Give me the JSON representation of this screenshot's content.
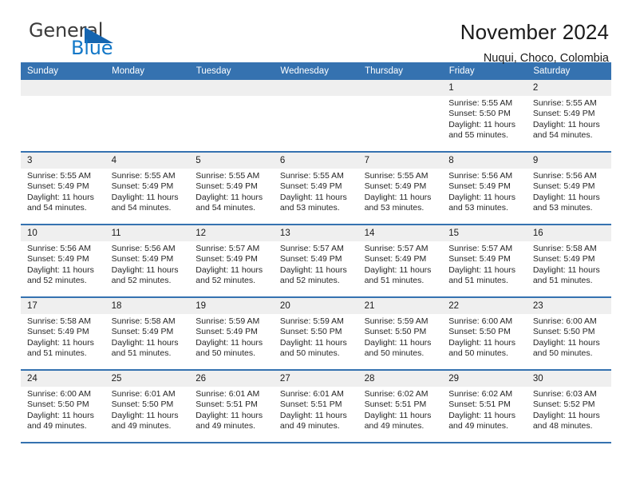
{
  "brand": {
    "name_part1": "General",
    "name_part2": "Blue",
    "triangle_icon": "triangle-icon"
  },
  "header": {
    "title": "November 2024",
    "subtitle": "Nuqui, Choco, Colombia"
  },
  "colors": {
    "header_blue": "#3572b0",
    "brand_blue": "#1378c8",
    "daynum_gray": "#efefef"
  },
  "calendar": {
    "weekdays": [
      "Sunday",
      "Monday",
      "Tuesday",
      "Wednesday",
      "Thursday",
      "Friday",
      "Saturday"
    ],
    "labels": {
      "sunrise": "Sunrise:",
      "sunset": "Sunset:",
      "daylight": "Daylight:"
    },
    "weeks": [
      [
        {
          "day": ""
        },
        {
          "day": ""
        },
        {
          "day": ""
        },
        {
          "day": ""
        },
        {
          "day": ""
        },
        {
          "day": "1",
          "sunrise": "Sunrise: 5:55 AM",
          "sunset": "Sunset: 5:50 PM",
          "daylight_1": "Daylight: 11 hours",
          "daylight_2": "and 55 minutes."
        },
        {
          "day": "2",
          "sunrise": "Sunrise: 5:55 AM",
          "sunset": "Sunset: 5:49 PM",
          "daylight_1": "Daylight: 11 hours",
          "daylight_2": "and 54 minutes."
        }
      ],
      [
        {
          "day": "3",
          "sunrise": "Sunrise: 5:55 AM",
          "sunset": "Sunset: 5:49 PM",
          "daylight_1": "Daylight: 11 hours",
          "daylight_2": "and 54 minutes."
        },
        {
          "day": "4",
          "sunrise": "Sunrise: 5:55 AM",
          "sunset": "Sunset: 5:49 PM",
          "daylight_1": "Daylight: 11 hours",
          "daylight_2": "and 54 minutes."
        },
        {
          "day": "5",
          "sunrise": "Sunrise: 5:55 AM",
          "sunset": "Sunset: 5:49 PM",
          "daylight_1": "Daylight: 11 hours",
          "daylight_2": "and 54 minutes."
        },
        {
          "day": "6",
          "sunrise": "Sunrise: 5:55 AM",
          "sunset": "Sunset: 5:49 PM",
          "daylight_1": "Daylight: 11 hours",
          "daylight_2": "and 53 minutes."
        },
        {
          "day": "7",
          "sunrise": "Sunrise: 5:55 AM",
          "sunset": "Sunset: 5:49 PM",
          "daylight_1": "Daylight: 11 hours",
          "daylight_2": "and 53 minutes."
        },
        {
          "day": "8",
          "sunrise": "Sunrise: 5:56 AM",
          "sunset": "Sunset: 5:49 PM",
          "daylight_1": "Daylight: 11 hours",
          "daylight_2": "and 53 minutes."
        },
        {
          "day": "9",
          "sunrise": "Sunrise: 5:56 AM",
          "sunset": "Sunset: 5:49 PM",
          "daylight_1": "Daylight: 11 hours",
          "daylight_2": "and 53 minutes."
        }
      ],
      [
        {
          "day": "10",
          "sunrise": "Sunrise: 5:56 AM",
          "sunset": "Sunset: 5:49 PM",
          "daylight_1": "Daylight: 11 hours",
          "daylight_2": "and 52 minutes."
        },
        {
          "day": "11",
          "sunrise": "Sunrise: 5:56 AM",
          "sunset": "Sunset: 5:49 PM",
          "daylight_1": "Daylight: 11 hours",
          "daylight_2": "and 52 minutes."
        },
        {
          "day": "12",
          "sunrise": "Sunrise: 5:57 AM",
          "sunset": "Sunset: 5:49 PM",
          "daylight_1": "Daylight: 11 hours",
          "daylight_2": "and 52 minutes."
        },
        {
          "day": "13",
          "sunrise": "Sunrise: 5:57 AM",
          "sunset": "Sunset: 5:49 PM",
          "daylight_1": "Daylight: 11 hours",
          "daylight_2": "and 52 minutes."
        },
        {
          "day": "14",
          "sunrise": "Sunrise: 5:57 AM",
          "sunset": "Sunset: 5:49 PM",
          "daylight_1": "Daylight: 11 hours",
          "daylight_2": "and 51 minutes."
        },
        {
          "day": "15",
          "sunrise": "Sunrise: 5:57 AM",
          "sunset": "Sunset: 5:49 PM",
          "daylight_1": "Daylight: 11 hours",
          "daylight_2": "and 51 minutes."
        },
        {
          "day": "16",
          "sunrise": "Sunrise: 5:58 AM",
          "sunset": "Sunset: 5:49 PM",
          "daylight_1": "Daylight: 11 hours",
          "daylight_2": "and 51 minutes."
        }
      ],
      [
        {
          "day": "17",
          "sunrise": "Sunrise: 5:58 AM",
          "sunset": "Sunset: 5:49 PM",
          "daylight_1": "Daylight: 11 hours",
          "daylight_2": "and 51 minutes."
        },
        {
          "day": "18",
          "sunrise": "Sunrise: 5:58 AM",
          "sunset": "Sunset: 5:49 PM",
          "daylight_1": "Daylight: 11 hours",
          "daylight_2": "and 51 minutes."
        },
        {
          "day": "19",
          "sunrise": "Sunrise: 5:59 AM",
          "sunset": "Sunset: 5:49 PM",
          "daylight_1": "Daylight: 11 hours",
          "daylight_2": "and 50 minutes."
        },
        {
          "day": "20",
          "sunrise": "Sunrise: 5:59 AM",
          "sunset": "Sunset: 5:50 PM",
          "daylight_1": "Daylight: 11 hours",
          "daylight_2": "and 50 minutes."
        },
        {
          "day": "21",
          "sunrise": "Sunrise: 5:59 AM",
          "sunset": "Sunset: 5:50 PM",
          "daylight_1": "Daylight: 11 hours",
          "daylight_2": "and 50 minutes."
        },
        {
          "day": "22",
          "sunrise": "Sunrise: 6:00 AM",
          "sunset": "Sunset: 5:50 PM",
          "daylight_1": "Daylight: 11 hours",
          "daylight_2": "and 50 minutes."
        },
        {
          "day": "23",
          "sunrise": "Sunrise: 6:00 AM",
          "sunset": "Sunset: 5:50 PM",
          "daylight_1": "Daylight: 11 hours",
          "daylight_2": "and 50 minutes."
        }
      ],
      [
        {
          "day": "24",
          "sunrise": "Sunrise: 6:00 AM",
          "sunset": "Sunset: 5:50 PM",
          "daylight_1": "Daylight: 11 hours",
          "daylight_2": "and 49 minutes."
        },
        {
          "day": "25",
          "sunrise": "Sunrise: 6:01 AM",
          "sunset": "Sunset: 5:50 PM",
          "daylight_1": "Daylight: 11 hours",
          "daylight_2": "and 49 minutes."
        },
        {
          "day": "26",
          "sunrise": "Sunrise: 6:01 AM",
          "sunset": "Sunset: 5:51 PM",
          "daylight_1": "Daylight: 11 hours",
          "daylight_2": "and 49 minutes."
        },
        {
          "day": "27",
          "sunrise": "Sunrise: 6:01 AM",
          "sunset": "Sunset: 5:51 PM",
          "daylight_1": "Daylight: 11 hours",
          "daylight_2": "and 49 minutes."
        },
        {
          "day": "28",
          "sunrise": "Sunrise: 6:02 AM",
          "sunset": "Sunset: 5:51 PM",
          "daylight_1": "Daylight: 11 hours",
          "daylight_2": "and 49 minutes."
        },
        {
          "day": "29",
          "sunrise": "Sunrise: 6:02 AM",
          "sunset": "Sunset: 5:51 PM",
          "daylight_1": "Daylight: 11 hours",
          "daylight_2": "and 49 minutes."
        },
        {
          "day": "30",
          "sunrise": "Sunrise: 6:03 AM",
          "sunset": "Sunset: 5:52 PM",
          "daylight_1": "Daylight: 11 hours",
          "daylight_2": "and 48 minutes."
        }
      ]
    ]
  }
}
